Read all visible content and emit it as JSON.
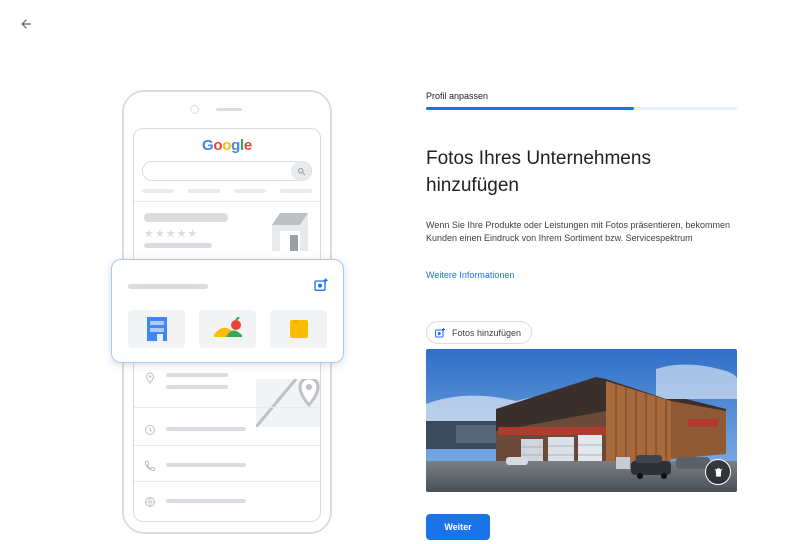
{
  "nav": {
    "back_icon": "arrow-back-icon"
  },
  "illustration": {
    "google_logo": {
      "letters": [
        "G",
        "o",
        "o",
        "g",
        "l",
        "e"
      ],
      "colors": [
        "#4285F4",
        "#EA4335",
        "#FBBC05",
        "#4285F4",
        "#34A853",
        "#EA4335"
      ]
    },
    "stars": "★★★★★",
    "icons": [
      "search-icon",
      "store-icon",
      "add-photo-icon",
      "storefront-icon",
      "fruit-bowl-icon",
      "sticky-note-icon",
      "location-pin-icon",
      "map-icon",
      "clock-icon",
      "phone-icon",
      "globe-icon"
    ]
  },
  "step": {
    "label": "Profil anpassen",
    "progress": 0.67
  },
  "content": {
    "title": "Fotos Ihres Unternehmens hinzufügen",
    "description": "Wenn Sie Ihre Produkte oder Leistungen mit Fotos präsentieren, bekommen Kunden einen Eindruck von Ihrem Sortiment bzw. Servicespektrum",
    "more_link": "Weitere Informationen",
    "add_photos_label": "Fotos hinzufügen",
    "add_photos_icon": "add-photo-icon",
    "photo": {
      "delete_icon": "trash-icon"
    },
    "next_label": "Weiter"
  },
  "colors": {
    "accent": "#1a73e8",
    "progress_track": "#e8f0fe",
    "card_border": "#a8c7fa"
  }
}
